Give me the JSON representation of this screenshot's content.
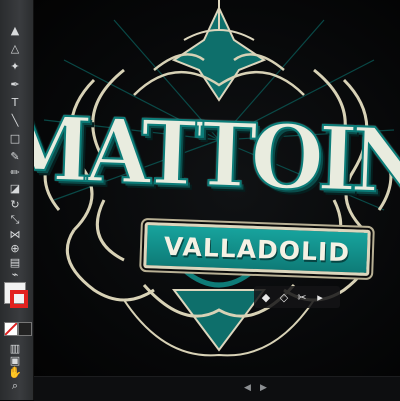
{
  "artwork": {
    "logo_text": "MATTOINK",
    "banner_text": "VALLADOLID"
  },
  "toolbar": {
    "tools": [
      {
        "icon": "selection-arrow-icon",
        "glyph": "▲"
      },
      {
        "icon": "direct-selection-icon",
        "glyph": "△"
      },
      {
        "icon": "magic-wand-icon",
        "glyph": "✦"
      },
      {
        "icon": "pen-tool-icon",
        "glyph": "✒"
      },
      {
        "icon": "type-tool-icon",
        "glyph": "T"
      },
      {
        "icon": "line-tool-icon",
        "glyph": "╲"
      },
      {
        "icon": "rectangle-tool-icon",
        "glyph": "□"
      },
      {
        "icon": "paintbrush-icon",
        "glyph": "✎"
      },
      {
        "icon": "pencil-icon",
        "glyph": "✏"
      },
      {
        "icon": "eraser-icon",
        "glyph": "◪"
      },
      {
        "icon": "rotate-icon",
        "glyph": "↻"
      },
      {
        "icon": "scale-icon",
        "glyph": "⤡"
      },
      {
        "icon": "width-tool-icon",
        "glyph": "⋈"
      },
      {
        "icon": "shape-builder-icon",
        "glyph": "⊕"
      },
      {
        "icon": "gradient-icon",
        "glyph": "▤"
      },
      {
        "icon": "eyedropper-icon",
        "glyph": "⌁"
      },
      {
        "icon": "graph-tool-icon",
        "glyph": "▥"
      },
      {
        "icon": "artboard-icon",
        "glyph": "▣"
      },
      {
        "icon": "hand-icon",
        "glyph": "✋"
      },
      {
        "icon": "zoom-icon",
        "glyph": "⌕"
      }
    ],
    "fill_color": "#f2f2f2",
    "stroke_color": "#e2221f"
  },
  "floating_toolbar": {
    "items": [
      {
        "icon": "anchor-convert-icon",
        "glyph": "◆"
      },
      {
        "icon": "smooth-anchor-icon",
        "glyph": "◇"
      },
      {
        "icon": "cut-path-icon",
        "glyph": "✂"
      },
      {
        "icon": "more-options-icon",
        "glyph": "▸"
      }
    ]
  },
  "colors": {
    "teal": "#0e7b77",
    "cream": "#dcd6bd",
    "ink": "#050607"
  }
}
